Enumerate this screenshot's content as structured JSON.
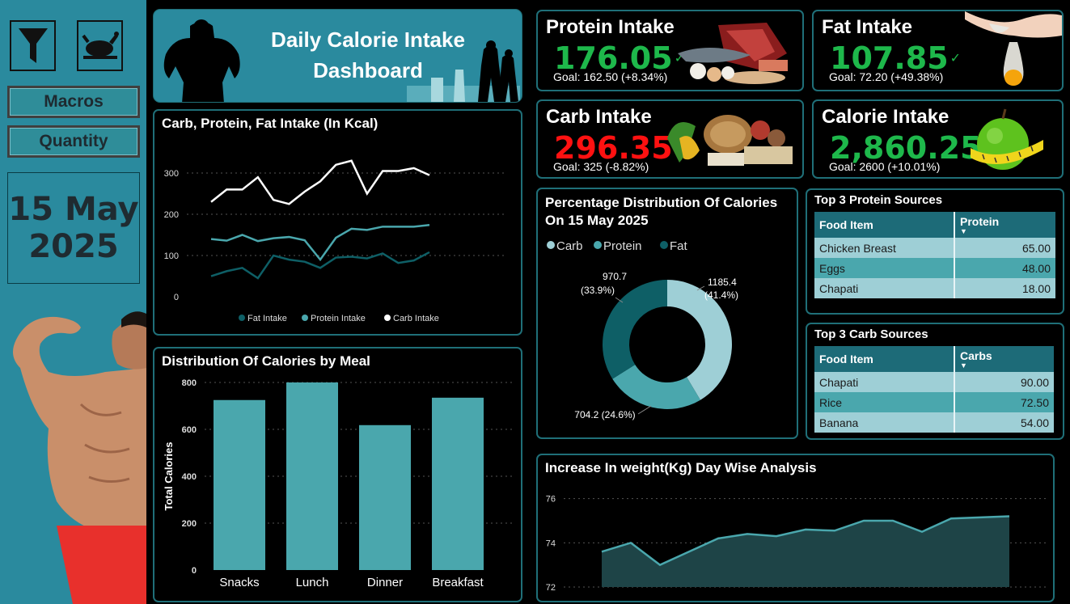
{
  "sidebar": {
    "buttons": [
      "Macros",
      "Quantity"
    ],
    "date_day": "15 May",
    "date_year": "2025",
    "icons": [
      "filter-icon",
      "roast-chicken-icon"
    ]
  },
  "header": {
    "title_line1": "Daily Calorie Intake",
    "title_line2": "Dashboard"
  },
  "kpis": {
    "protein": {
      "label": "Protein Intake",
      "value": "176.05",
      "goal": "Goal: 162.50 (+8.34%)",
      "status": "up"
    },
    "fat": {
      "label": "Fat Intake",
      "value": "107.85",
      "goal": "Goal: 72.20 (+49.38%)",
      "status": "up"
    },
    "carb": {
      "label": "Carb Intake",
      "value": "296.35",
      "goal": "Goal: 325 (-8.82%)",
      "status": "down"
    },
    "calorie": {
      "label": "Calorie Intake",
      "value": "2,860.25",
      "goal": "Goal: 2600 (+10.01%)",
      "status": "up"
    }
  },
  "colors": {
    "sidebar": "#2a8a9e",
    "dark_teal": "#0e5f66",
    "mid_teal": "#4aa7ad",
    "light_teal": "#9ecfd6",
    "green": "#1eb84b",
    "red": "#ff1111"
  },
  "protein_table": {
    "title": "Top 3 Protein Sources",
    "headers": [
      "Food Item",
      "Protein"
    ],
    "rows": [
      [
        "Chicken Breast",
        "65.00"
      ],
      [
        "Eggs",
        "48.00"
      ],
      [
        "Chapati",
        "18.00"
      ]
    ]
  },
  "carb_table": {
    "title": "Top 3 Carb Sources",
    "headers": [
      "Food Item",
      "Carbs"
    ],
    "rows": [
      [
        "Chapati",
        "90.00"
      ],
      [
        "Rice",
        "72.50"
      ],
      [
        "Banana",
        "54.00"
      ]
    ]
  },
  "chart_data": [
    {
      "id": "macro_line",
      "type": "line",
      "title": "Carb, Protein, Fat Intake (In Kcal)",
      "ylim": [
        0,
        340
      ],
      "yticks": [
        0,
        100,
        200,
        300
      ],
      "grid": true,
      "legend_position": "bottom",
      "x": [
        1,
        2,
        3,
        4,
        5,
        6,
        7,
        8,
        9,
        10,
        11,
        12,
        13,
        14,
        15
      ],
      "series": [
        {
          "name": "Fat Intake",
          "color": "#0e5f66",
          "values": [
            50,
            62,
            70,
            45,
            100,
            90,
            85,
            70,
            95,
            97,
            93,
            105,
            82,
            88,
            108
          ]
        },
        {
          "name": "Protein Intake",
          "color": "#4aa7ad",
          "values": [
            140,
            136,
            150,
            135,
            142,
            145,
            137,
            90,
            143,
            165,
            162,
            170,
            170,
            170,
            174
          ]
        },
        {
          "name": "Carb Intake",
          "color": "#ffffff",
          "values": [
            230,
            260,
            260,
            290,
            235,
            225,
            255,
            280,
            320,
            330,
            250,
            305,
            305,
            312,
            295
          ]
        }
      ]
    },
    {
      "id": "meal_bar",
      "type": "bar",
      "title": "Distribution Of Calories by Meal",
      "ylabel": "Total Calories",
      "ylim": [
        0,
        800
      ],
      "yticks": [
        0,
        200,
        400,
        600,
        800
      ],
      "grid": true,
      "categories": [
        "Snacks",
        "Lunch",
        "Dinner",
        "Breakfast"
      ],
      "values": [
        725,
        800,
        618,
        735
      ],
      "color": "#4aa7ad"
    },
    {
      "id": "calorie_donut",
      "type": "pie",
      "title_line1": "Percentage Distribution Of Calories",
      "title_line2": "On 15 May 2025",
      "legend_position": "top-left",
      "slices": [
        {
          "name": "Carb",
          "value": 1185.4,
          "label": "1185.4",
          "pct": "(41.4%)",
          "color": "#9ecfd6"
        },
        {
          "name": "Protein",
          "value": 704.2,
          "label": "704.2 (24.6%)",
          "pct": "",
          "color": "#4aa7ad"
        },
        {
          "name": "Fat",
          "value": 970.7,
          "label": "970.7",
          "pct": "(33.9%)",
          "color": "#0e5f66"
        }
      ]
    },
    {
      "id": "weight_area",
      "type": "area",
      "title": "Increase In weight(Kg) Day Wise Analysis",
      "ylim": [
        72,
        76.5
      ],
      "yticks": [
        72,
        74,
        76
      ],
      "grid": true,
      "x": [
        1,
        2,
        3,
        4,
        5,
        6,
        7,
        8,
        9,
        10,
        11,
        12,
        13,
        14,
        15
      ],
      "values": [
        73.6,
        74.0,
        73.0,
        73.6,
        74.2,
        74.4,
        74.3,
        74.6,
        74.55,
        75.0,
        75.0,
        74.5,
        75.1,
        75.15,
        75.2
      ],
      "color": "#4aa7ad"
    }
  ]
}
